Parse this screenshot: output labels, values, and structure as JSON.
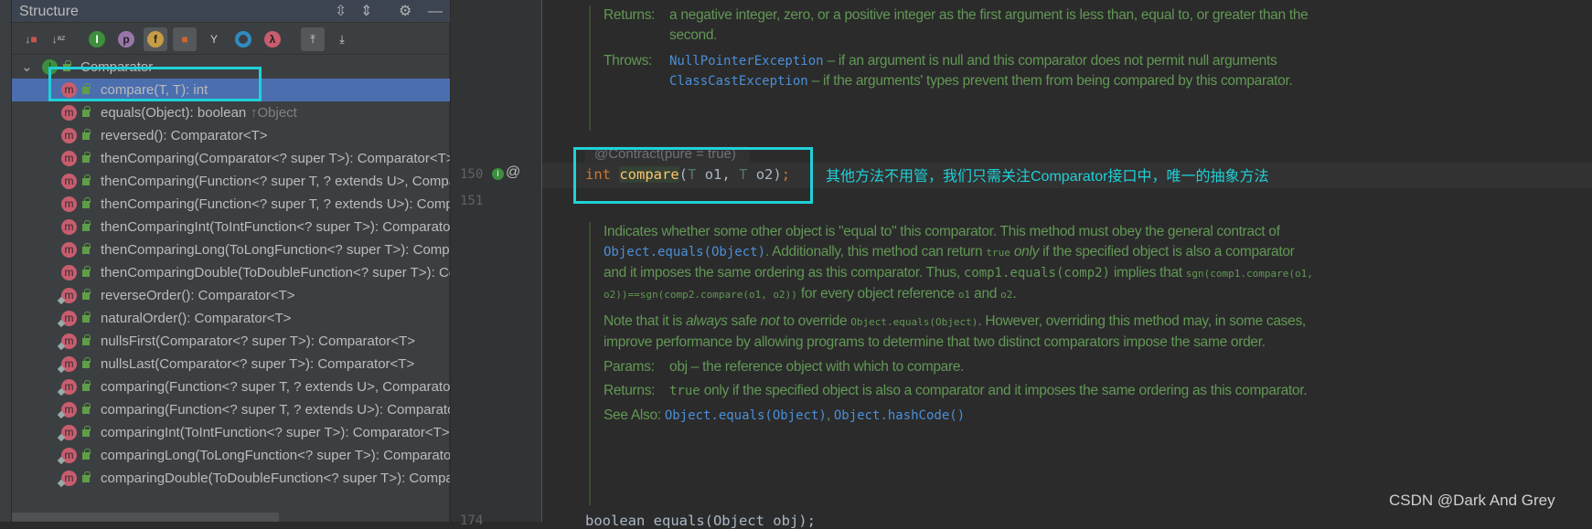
{
  "structure": {
    "title": "Structure",
    "header_icons": [
      "expand-all-icon",
      "collapse-all-icon",
      "gear-icon",
      "minimize-icon"
    ],
    "toolbar_icons": [
      "sort-by-visibility-icon",
      "sort-alphabetically-icon",
      "show-inherited-icon",
      "show-properties-icon",
      "show-fields-icon",
      "show-non-public-icon",
      "show-anonymous-icon",
      "show-lambdas-icon",
      "lambda-icon",
      "autoscroll-to-source-icon",
      "autoscroll-from-source-icon"
    ],
    "root": "Comparator",
    "items": [
      {
        "label": "compare(T, T): int",
        "selected": true
      },
      {
        "label": "equals(Object): boolean",
        "inherited": "↑Object"
      },
      {
        "label": "reversed(): Comparator<T>"
      },
      {
        "label": "thenComparing(Comparator<? super T>): Comparator<T>"
      },
      {
        "label": "thenComparing(Function<? super T, ? extends U>, Comparator<? super U>): Comparator<T>"
      },
      {
        "label": "thenComparing(Function<? super T, ? extends U>): Comparator<T>"
      },
      {
        "label": "thenComparingInt(ToIntFunction<? super T>): Comparator<T>"
      },
      {
        "label": "thenComparingLong(ToLongFunction<? super T>): Comparator<T>"
      },
      {
        "label": "thenComparingDouble(ToDoubleFunction<? super T>): Comparator<T>"
      },
      {
        "label": "reverseOrder(): Comparator<T>",
        "static": true
      },
      {
        "label": "naturalOrder(): Comparator<T>",
        "static": true
      },
      {
        "label": "nullsFirst(Comparator<? super T>): Comparator<T>",
        "static": true
      },
      {
        "label": "nullsLast(Comparator<? super T>): Comparator<T>",
        "static": true
      },
      {
        "label": "comparing(Function<? super T, ? extends U>, Comparator<? super U>): Comparator<T>",
        "static": true
      },
      {
        "label": "comparing(Function<? super T, ? extends U>): Comparator<T>",
        "static": true
      },
      {
        "label": "comparingInt(ToIntFunction<? super T>): Comparator<T>",
        "static": true
      },
      {
        "label": "comparingLong(ToLongFunction<? super T>): Comparator<T>",
        "static": true
      },
      {
        "label": "comparingDouble(ToDoubleFunction<? super T>): Comparator<T>",
        "static": true
      }
    ]
  },
  "editor": {
    "doc1": {
      "returns_tag": "Returns:",
      "returns_text": "a negative integer, zero, or a positive integer as the first argument is less than, equal to, or greater than the second.",
      "throws_tag": "Throws:",
      "throws1_link": "NullPointerException",
      "throws1_text": " – if an argument is null and this comparator does not permit null arguments",
      "throws2_link": "ClassCastException",
      "throws2_text": " – if the arguments' types prevent them from being compared by this comparator."
    },
    "annotation": "@Contract(pure = true)",
    "line150": "150",
    "line151": "151",
    "line174": "174",
    "code_int": "int",
    "code_method": "compare",
    "code_rest1": "(",
    "code_T1": "T",
    "code_o1": " o1, ",
    "code_T2": "T",
    "code_o2": " o2)",
    "code_semi": ";",
    "note": "其他方法不用管，我们只需关注Comparator接口中，唯一的抽象方法",
    "doc2": {
      "p1a": "Indicates whether some other object is \"equal to\" this comparator. This method must obey the general contract of ",
      "p1link": "Object.equals(Object)",
      "p1b": ". Additionally, this method can return ",
      "p1true": "true",
      "p1only": "only",
      "p1c": " if the specified object is also a comparator and it imposes the same ordering as this comparator. Thus, ",
      "p1code": "comp1.equals(comp2)",
      "p1d": " implies that ",
      "p1sgn": "sgn(comp1.compare(o1, o2))==sgn(comp2.compare(o1, o2))",
      "p1e": " for every object reference ",
      "p1o1": "o1",
      "p1and": " and ",
      "p1o2": "o2",
      "p1end": ".",
      "p2a": "Note that it is ",
      "p2always": "always",
      "p2b": " safe ",
      "p2not": "not",
      "p2c": " to override ",
      "p2code": "Object.equals(Object)",
      "p2d": ". However, overriding this method may, in some cases, improve performance by allowing programs to determine that two distinct comparators impose the same order.",
      "params_tag": "Params:",
      "params_text": "obj – the reference object with which to compare.",
      "returns_tag": "Returns:",
      "returns_code": "true",
      "returns_text": " only if the specified object is also a comparator and it imposes the same ordering as this comparator.",
      "see_tag": "See Also:",
      "see1": "Object.equals(Object)",
      "see_sep": ", ",
      "see2": "Object.hashCode()"
    },
    "last_code": "boolean equals(Object obj);"
  },
  "watermark": "CSDN @Dark And Grey",
  "colors": {
    "highlight": "#1fd1d8",
    "selection": "#4b6eaf",
    "doc": "#629755",
    "link": "#4a8fd8"
  }
}
